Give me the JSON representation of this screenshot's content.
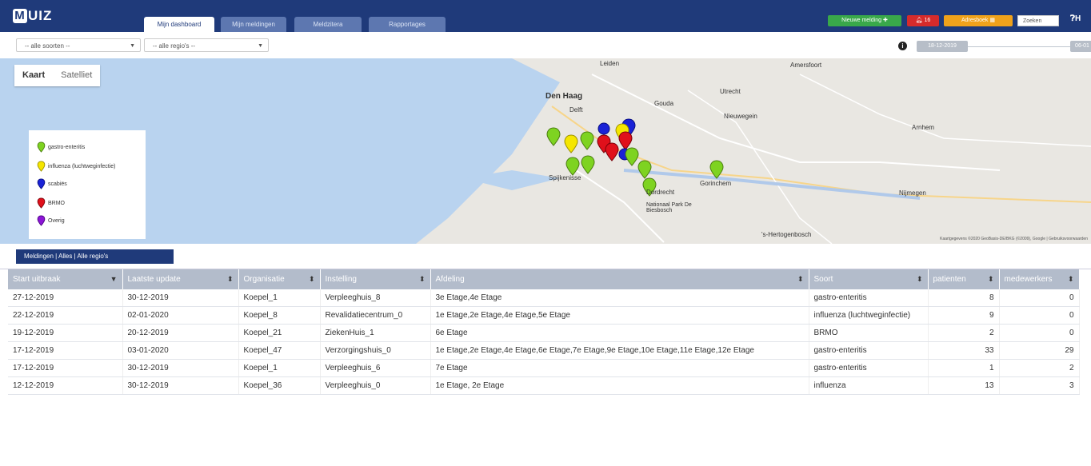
{
  "app": {
    "logo_letter": "M",
    "logo_text": "UIZ"
  },
  "nav": {
    "tabs": [
      {
        "label": "Mijn dashboard"
      },
      {
        "label": "Mijn meldingen"
      },
      {
        "label": "Meldzitera"
      },
      {
        "label": "Rapportages"
      }
    ],
    "new_report_label": "Nieuwe melding",
    "alerts_count": "16",
    "user_label": "Adresboek",
    "search_placeholder": "Zoeken",
    "help_label": "H"
  },
  "filters": {
    "species_select": "-- alle soorten --",
    "region_select": "-- alle regio's --",
    "date_from": "18-12-2019",
    "date_to": "06-01"
  },
  "map": {
    "type_options": [
      "Kaart",
      "Satelliet"
    ],
    "labels": {
      "den_haag": "Den Haag",
      "leiden": "Leiden",
      "amersfoort": "Amersfoort",
      "utrecht": "Utrecht",
      "gouda": "Gouda",
      "delft": "Delft",
      "nieuwegein": "Nieuwegein",
      "arnhem": "Arnhem",
      "dordrecht": "Dordrecht",
      "nijmegen": "Nijmegen",
      "spijkenisse": "Spijkenisse",
      "gorinchem": "Gorinchem",
      "hertogenbosch": "'s-Hertogenbosch",
      "biesbosch": "Nationaal Park De Biesbosch",
      "copyright": "Kaartgegevens ©2020 GeoBasis-DE/BKG (©2009), Google | Gebruiksvoorwaarden"
    },
    "legend": [
      {
        "label": "gastro-enteritis",
        "color": "#7ed321"
      },
      {
        "label": "influenza (luchtweginfectie)",
        "color": "#f5e600"
      },
      {
        "label": "scabiës",
        "color": "#1a22d6"
      },
      {
        "label": "BRMO",
        "color": "#e0101b"
      },
      {
        "label": "Overig",
        "color": "#8c15d6"
      }
    ]
  },
  "section_tab": "Meldingen | Alles | Alle regio's",
  "table": {
    "columns": [
      "Start uitbraak",
      "Laatste update",
      "Organisatie",
      "Instelling",
      "Afdeling",
      "Soort",
      "patienten",
      "medewerkers"
    ],
    "rows": [
      [
        "27-12-2019",
        "30-12-2019",
        "Koepel_1",
        "Verpleeghuis_8",
        "3e Etage,4e Etage",
        "gastro-enteritis",
        "8",
        "0"
      ],
      [
        "22-12-2019",
        "02-01-2020",
        "Koepel_8",
        "Revalidatiecentrum_0",
        "1e Etage,2e Etage,4e Etage,5e Etage",
        "influenza (luchtweginfectie)",
        "9",
        "0"
      ],
      [
        "19-12-2019",
        "20-12-2019",
        "Koepel_21",
        "ZiekenHuis_1",
        "6e Etage",
        "BRMO",
        "2",
        "0"
      ],
      [
        "17-12-2019",
        "03-01-2020",
        "Koepel_47",
        "Verzorgingshuis_0",
        "1e Etage,2e Etage,4e Etage,6e Etage,7e Etage,9e Etage,10e Etage,11e Etage,12e Etage",
        "gastro-enteritis",
        "33",
        "29"
      ],
      [
        "17-12-2019",
        "30-12-2019",
        "Koepel_1",
        "Verpleeghuis_6",
        "7e Etage",
        "gastro-enteritis",
        "1",
        "2"
      ],
      [
        "12-12-2019",
        "30-12-2019",
        "Koepel_36",
        "Verpleeghuis_0",
        "1e Etage, 2e Etage",
        "influenza",
        "13",
        "3"
      ]
    ]
  }
}
